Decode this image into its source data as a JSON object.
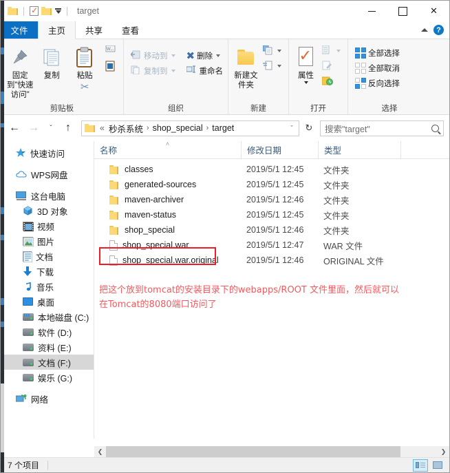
{
  "window": {
    "title": "target",
    "quick_access": [
      "folder-icon",
      "properties-icon",
      "new-folder-icon",
      "customize-dropdown"
    ],
    "controls": {
      "minimize": "─",
      "maximize": "□",
      "close": "✕"
    }
  },
  "ribbon": {
    "tabs": [
      {
        "label": "文件",
        "state": "file"
      },
      {
        "label": "主页",
        "state": "active"
      },
      {
        "label": "共享",
        "state": "normal"
      },
      {
        "label": "查看",
        "state": "normal"
      }
    ],
    "help_label": "?",
    "groups": [
      {
        "label": "剪贴板",
        "big_buttons": [
          {
            "label": "固定到\"快速访问\"",
            "icon": "pin-icon"
          },
          {
            "label": "复制",
            "icon": "copy-icon"
          },
          {
            "label": "粘贴",
            "icon": "paste-icon"
          }
        ],
        "small_buttons": [
          {
            "label": "",
            "icon": "copy-path-icon"
          },
          {
            "label": "",
            "icon": "paste-shortcut-icon"
          },
          {
            "label": "",
            "icon": "cut-icon"
          }
        ]
      },
      {
        "label": "组织",
        "small_buttons": [
          {
            "label": "移动到",
            "icon": "move-to-icon",
            "disabled": true,
            "dropdown": true
          },
          {
            "label": "复制到",
            "icon": "copy-to-icon",
            "disabled": true,
            "dropdown": true
          },
          {
            "label": "删除",
            "icon": "delete-icon",
            "disabled": false,
            "dropdown": true
          },
          {
            "label": "重命名",
            "icon": "rename-icon",
            "disabled": false,
            "dropdown": false
          }
        ]
      },
      {
        "label": "新建",
        "big_buttons": [
          {
            "label": "新建文件夹",
            "icon": "new-folder-icon"
          }
        ],
        "small_buttons": [
          {
            "label": "",
            "icon": "new-item-icon",
            "dropdown": true
          },
          {
            "label": "",
            "icon": "easy-access-icon",
            "dropdown": true
          }
        ]
      },
      {
        "label": "打开",
        "big_buttons": [
          {
            "label": "属性",
            "icon": "properties-icon"
          }
        ],
        "small_buttons": [
          {
            "label": "",
            "icon": "open-icon",
            "dropdown": true,
            "disabled": true
          },
          {
            "label": "",
            "icon": "edit-icon",
            "disabled": true
          },
          {
            "label": "",
            "icon": "history-icon"
          }
        ]
      },
      {
        "label": "选择",
        "small_buttons": [
          {
            "label": "全部选择",
            "icon": "select-all-icon"
          },
          {
            "label": "全部取消",
            "icon": "select-none-icon"
          },
          {
            "label": "反向选择",
            "icon": "invert-selection-icon"
          }
        ]
      }
    ]
  },
  "address": {
    "back": "←",
    "forward": "→",
    "recent": "ˇ",
    "up": "↑",
    "crumbs": [
      "«",
      "秒杀系统",
      "shop_special",
      "target"
    ],
    "separator": "›",
    "dropdown": "ˇ",
    "refresh": "↻",
    "search_placeholder": "搜索\"target\""
  },
  "navpane": {
    "items": [
      {
        "label": "快速访问",
        "icon": "quick-access-star-icon",
        "level": 0,
        "selected": false
      },
      {
        "label": "WPS网盘",
        "icon": "wps-cloud-icon",
        "level": 0,
        "selected": false
      },
      {
        "label": "这台电脑",
        "icon": "this-pc-icon",
        "level": 0,
        "selected": false
      },
      {
        "label": "3D 对象",
        "icon": "3d-objects-icon",
        "level": 1,
        "selected": false
      },
      {
        "label": "视频",
        "icon": "videos-icon",
        "level": 1,
        "selected": false
      },
      {
        "label": "图片",
        "icon": "pictures-icon",
        "level": 1,
        "selected": false
      },
      {
        "label": "文档",
        "icon": "documents-icon",
        "level": 1,
        "selected": false
      },
      {
        "label": "下载",
        "icon": "downloads-icon",
        "level": 1,
        "selected": false
      },
      {
        "label": "音乐",
        "icon": "music-icon",
        "level": 1,
        "selected": false
      },
      {
        "label": "桌面",
        "icon": "desktop-icon",
        "level": 1,
        "selected": false
      },
      {
        "label": "本地磁盘 (C:)",
        "icon": "system-drive-icon",
        "level": 1,
        "selected": false
      },
      {
        "label": "软件 (D:)",
        "icon": "drive-icon",
        "level": 1,
        "selected": false
      },
      {
        "label": "资料 (E:)",
        "icon": "drive-icon",
        "level": 1,
        "selected": false
      },
      {
        "label": "文档 (F:)",
        "icon": "drive-icon",
        "level": 1,
        "selected": true
      },
      {
        "label": "娱乐 (G:)",
        "icon": "drive-icon",
        "level": 1,
        "selected": false
      },
      {
        "label": "网络",
        "icon": "network-icon",
        "level": 0,
        "selected": false
      }
    ]
  },
  "filelist": {
    "columns": [
      "名称",
      "修改日期",
      "类型",
      ""
    ],
    "sort_indicator": "˄",
    "rows": [
      {
        "name": "classes",
        "date": "2019/5/1 12:45",
        "type": "文件夹",
        "icon": "folder-icon",
        "highlighted": false
      },
      {
        "name": "generated-sources",
        "date": "2019/5/1 12:45",
        "type": "文件夹",
        "icon": "folder-icon",
        "highlighted": false
      },
      {
        "name": "maven-archiver",
        "date": "2019/5/1 12:46",
        "type": "文件夹",
        "icon": "folder-icon",
        "highlighted": false
      },
      {
        "name": "maven-status",
        "date": "2019/5/1 12:45",
        "type": "文件夹",
        "icon": "folder-icon",
        "highlighted": false
      },
      {
        "name": "shop_special",
        "date": "2019/5/1 12:46",
        "type": "文件夹",
        "icon": "folder-icon",
        "highlighted": false
      },
      {
        "name": "shop_special.war",
        "date": "2019/5/1 12:47",
        "type": "WAR 文件",
        "icon": "file-icon",
        "highlighted": true
      },
      {
        "name": "shop_special.war.original",
        "date": "2019/5/1 12:46",
        "type": "ORIGINAL 文件",
        "icon": "file-icon",
        "highlighted": false
      }
    ]
  },
  "annotation": {
    "line1": "把这个放到tomcat的安装目录下的webapps/ROOT 文件里面，然后就可以",
    "line2": "在Tomcat的8080端口访问了",
    "color": "#f4595e"
  },
  "statusbar": {
    "item_count": "7 个项目",
    "view_details": "details-view",
    "view_icons": "large-icons-view"
  },
  "colors": {
    "accent": "#0b70c4",
    "highlight_red": "#ee1c25",
    "selection_gray": "#d7d7d7",
    "folder_yellow": "#fbd977"
  }
}
